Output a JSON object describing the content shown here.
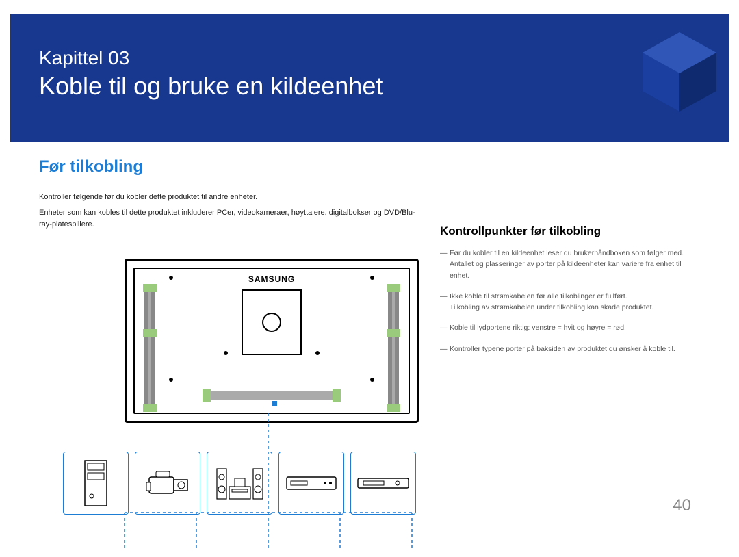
{
  "chapter_label": "Kapittel  03",
  "chapter_title": "Koble til og bruke en kildeenhet",
  "section_heading": "Før tilkobling",
  "intro_line1": "Kontroller følgende før du kobler dette produktet til andre enheter.",
  "intro_line2": "Enheter som kan kobles til dette produktet inkluderer PCer, videokameraer, høyttalere, digitalbokser og DVD/Blu-ray-platespillere.",
  "tv_brand": "SAMSUNG",
  "right": {
    "heading": "Kontrollpunkter før tilkobling",
    "notes": [
      {
        "main": "Før du kobler til en kildeenhet leser du brukerhåndboken som følger med.",
        "sub": "Antallet og plasseringer av porter på kildeenheter kan variere fra enhet til enhet."
      },
      {
        "main": "Ikke koble til strømkabelen før alle tilkoblinger er fullført.",
        "sub": "Tilkobling av strømkabelen under tilkobling kan skade produktet."
      },
      {
        "main": "Koble til lydportene riktig: venstre = hvit og høyre = rød.",
        "sub": ""
      },
      {
        "main": "Kontroller typene porter på baksiden av produktet du ønsker å koble til.",
        "sub": ""
      }
    ]
  },
  "page_number": "40"
}
